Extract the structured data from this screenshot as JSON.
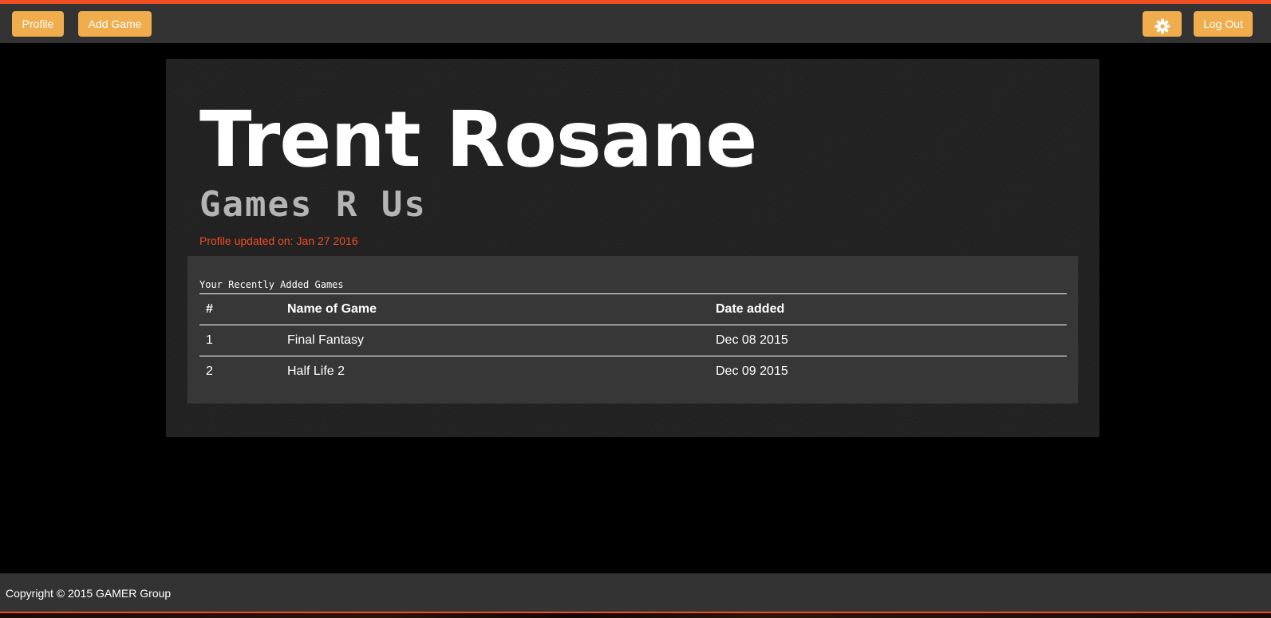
{
  "navbar": {
    "profile_label": "Profile",
    "add_game_label": "Add Game",
    "settings_icon": "gear-icon",
    "logout_label": "Log Out",
    "button_color": "#f0ad4e"
  },
  "profile": {
    "name": "Trent Rosane",
    "tagline": "Games R Us",
    "updated_label": "Profile updated on:",
    "updated_date": "Jan 27 2016"
  },
  "games": {
    "caption": "Your Recently Added Games",
    "headers": {
      "number": "#",
      "name": "Name of Game",
      "date": "Date added"
    },
    "rows": [
      {
        "number": "1",
        "name": "Final Fantasy",
        "date": "Dec 08 2015"
      },
      {
        "number": "2",
        "name": "Half Life 2",
        "date": "Dec 09 2015"
      }
    ]
  },
  "footer": {
    "copyright": "Copyright © 2015 GAMER Group"
  },
  "colors": {
    "accent": "#f04e23",
    "bar": "#333333"
  }
}
